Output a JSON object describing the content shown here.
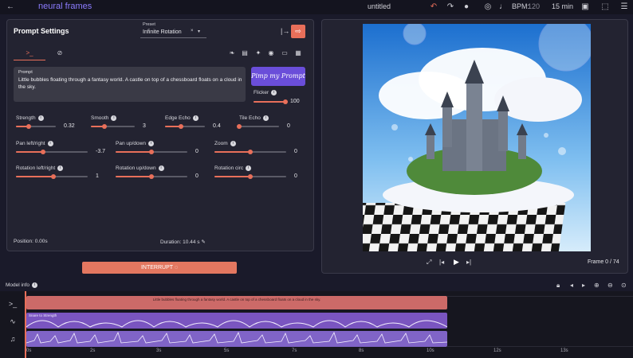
{
  "topbar": {
    "brand": "neural frames",
    "title": "untitled",
    "bpm_label": "BPM:",
    "bpm_value": "120",
    "duration": "15 min"
  },
  "settings": {
    "title": "Prompt Settings",
    "preset_label": "Preset",
    "preset_value": "Infinite Rotation",
    "prompt_label": "Prompt",
    "prompt_text": "Little bubbles floating through a fantasy world. A castle on top of a chessboard floats on a cloud in the sky.",
    "pimp_label": "Pimp my Prompt",
    "flicker_label": "Flicker",
    "flicker_value": "100",
    "flicker_level": 1.0,
    "position": "Position: 0.00s",
    "duration": "Duration: 10.44 s"
  },
  "sliders": [
    {
      "label": "Strength",
      "value": "0.32",
      "level": 0.32
    },
    {
      "label": "Smooth",
      "value": "3",
      "level": 0.3
    },
    {
      "label": "Edge Echo",
      "value": "0.4",
      "level": 0.4
    },
    {
      "label": "Tile Echo",
      "value": "0",
      "level": 0.0
    },
    {
      "label": "Pan left/right",
      "value": "-3.7",
      "level": 0.38
    },
    {
      "label": "Pan up/down",
      "value": "0",
      "level": 0.5
    },
    {
      "label": "Zoom",
      "value": "0",
      "level": 0.5
    },
    {
      "label": "Rotation left/right",
      "value": "1",
      "level": 0.52
    },
    {
      "label": "Rotation up/down",
      "value": "0",
      "level": 0.5
    },
    {
      "label": "Rotation circ",
      "value": "0",
      "level": 0.5
    }
  ],
  "interrupt_label": "INTERRUPT",
  "preview": {
    "frame": "Frame 0 / 74"
  },
  "model_info": "Model info",
  "timeline": {
    "prompt_clip": "Little bubbles floating through a fantasy world. A castle on top of a chessboard floats on a cloud in the sky.",
    "modulation_clip": "Snare to Strength",
    "ticks": [
      "0s",
      "2s",
      "3s",
      "5s",
      "7s",
      "8s",
      "10s",
      "12s",
      "13s"
    ]
  },
  "colors": {
    "accent": "#e86f5a",
    "purple": "#6a4ed9",
    "brand": "#8c7cff"
  }
}
